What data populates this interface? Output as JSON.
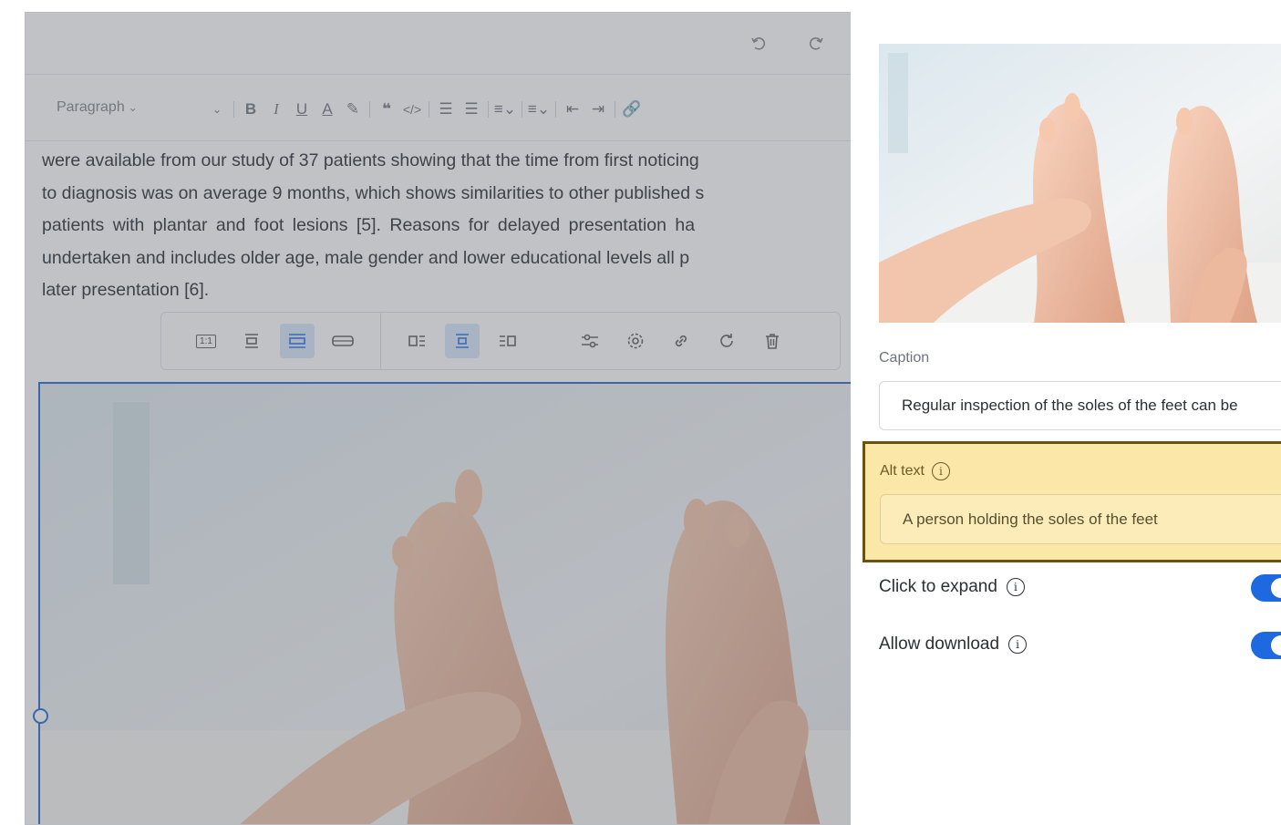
{
  "editor": {
    "format_bar": {
      "paragraph_label": "Paragraph"
    },
    "body_lines": [
      "were available from our study of 37 patients showing that the time from first noticing",
      "to diagnosis was on average 9 months, which shows similarities to other published s",
      "patients with plantar and foot lesions [5]. Reasons for delayed presentation ha",
      "undertaken and includes older age, male gender and lower educational levels all p",
      "later presentation [6]."
    ],
    "image_toolbar": {
      "ratio_label": "1:1"
    }
  },
  "panel": {
    "caption": {
      "label": "Caption",
      "value": "Regular inspection of the soles of the feet can be"
    },
    "alt_text": {
      "label": "Alt text",
      "value": "A person holding the soles of the feet"
    },
    "toggles": [
      {
        "label": "Click to expand",
        "on": true
      },
      {
        "label": "Allow download",
        "on": true
      }
    ]
  },
  "colors": {
    "accent": "#1f69e0",
    "highlight": "#fbe7a8",
    "highlight_border": "#6a5310"
  }
}
